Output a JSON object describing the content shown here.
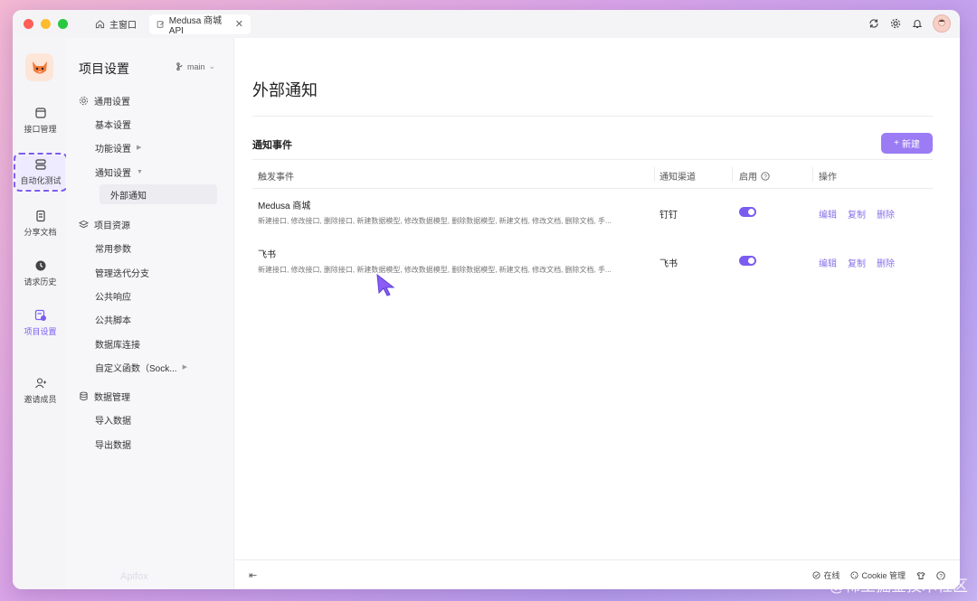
{
  "tabs": {
    "home_label": "主窗口",
    "active_label": "Medusa 商城 API",
    "close": "✕"
  },
  "rail": {
    "items": [
      {
        "label": "接口管理"
      },
      {
        "label": "自动化测试"
      },
      {
        "label": "分享文档"
      },
      {
        "label": "请求历史"
      },
      {
        "label": "项目设置"
      },
      {
        "label": "邀请成员"
      }
    ]
  },
  "side": {
    "title": "项目设置",
    "branch": "main",
    "general_group": "通用设置",
    "basic": "基本设置",
    "feature": "功能设置",
    "notify": "通知设置",
    "external_notify": "外部通知",
    "resource_group": "项目资源",
    "common_params": "常用参数",
    "iteration": "管理迭代分支",
    "public_response": "公共响应",
    "public_script": "公共脚本",
    "db_conn": "数据库连接",
    "custom_func": "自定义函数（Sock...",
    "data_group": "数据管理",
    "import": "导入数据",
    "export": "导出数据",
    "brand": "Apifox"
  },
  "main": {
    "page_title": "外部通知",
    "section_title": "通知事件",
    "new_button": "新建",
    "columns": {
      "event": "触发事件",
      "channel": "通知渠道",
      "enabled": "启用",
      "actions": "操作"
    },
    "rows": [
      {
        "name": "Medusa 商城",
        "events": "新建接口, 修改接口, 删除接口, 新建数据模型, 修改数据模型, 删除数据模型, 新建文档, 修改文档, 删除文档, 手...",
        "channel": "钉钉",
        "enabled": true
      },
      {
        "name": "飞书",
        "events": "新建接口, 修改接口, 删除接口, 新建数据模型, 修改数据模型, 删除数据模型, 新建文档, 修改文档, 删除文档, 手...",
        "channel": "飞书",
        "enabled": true
      }
    ],
    "actions": {
      "edit": "编辑",
      "copy": "复制",
      "delete": "删除"
    }
  },
  "status": {
    "online": "在线",
    "cookie": "Cookie 管理"
  },
  "watermark": "@稀土掘金技术社区",
  "colors": {
    "accent": "#7b5cf0",
    "button": "#9b7cf4",
    "link": "#8a72e8"
  }
}
